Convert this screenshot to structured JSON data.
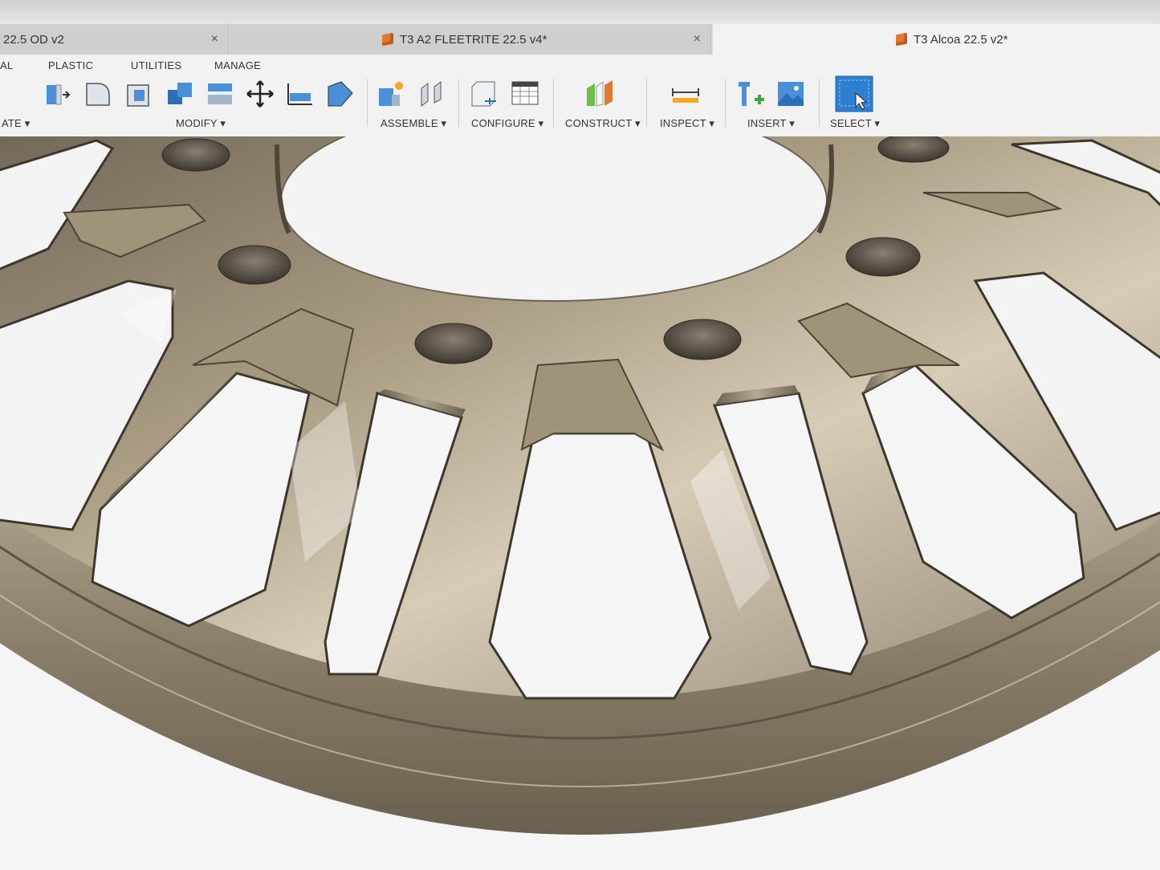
{
  "tabs": [
    {
      "label": "22.5 OD v2",
      "close": "×"
    },
    {
      "label": "T3 A2  FLEETRITE 22.5 v4*",
      "close": "×"
    },
    {
      "label": "T3 Alcoa 22.5 v2*"
    }
  ],
  "toolbar": {
    "menus": [
      "AL",
      "PLASTIC",
      "UTILITIES",
      "MANAGE"
    ],
    "groups": {
      "create": "ATE ▾",
      "modify": "MODIFY ▾",
      "assemble": "ASSEMBLE ▾",
      "configure": "CONFIGURE ▾",
      "construct": "CONSTRUCT ▾",
      "inspect": "INSPECT ▾",
      "insert": "INSERT ▾",
      "select": "SELECT ▾"
    }
  },
  "icons": [
    "press-pull-icon",
    "fillet-icon",
    "chamfer-icon",
    "combine-icon",
    "offset-face-icon",
    "move-icon",
    "align-icon",
    "scale-icon",
    "new-component-icon",
    "joint-icon",
    "configure-icon",
    "table-icon",
    "construct-plane-icon",
    "measure-icon",
    "insert-derive-icon",
    "insert-image-icon",
    "select-icon"
  ],
  "colors": {
    "accent_orange": "#e07a2e",
    "select_blue": "#2f7fd1",
    "model_metal": "#8a7f6a"
  }
}
